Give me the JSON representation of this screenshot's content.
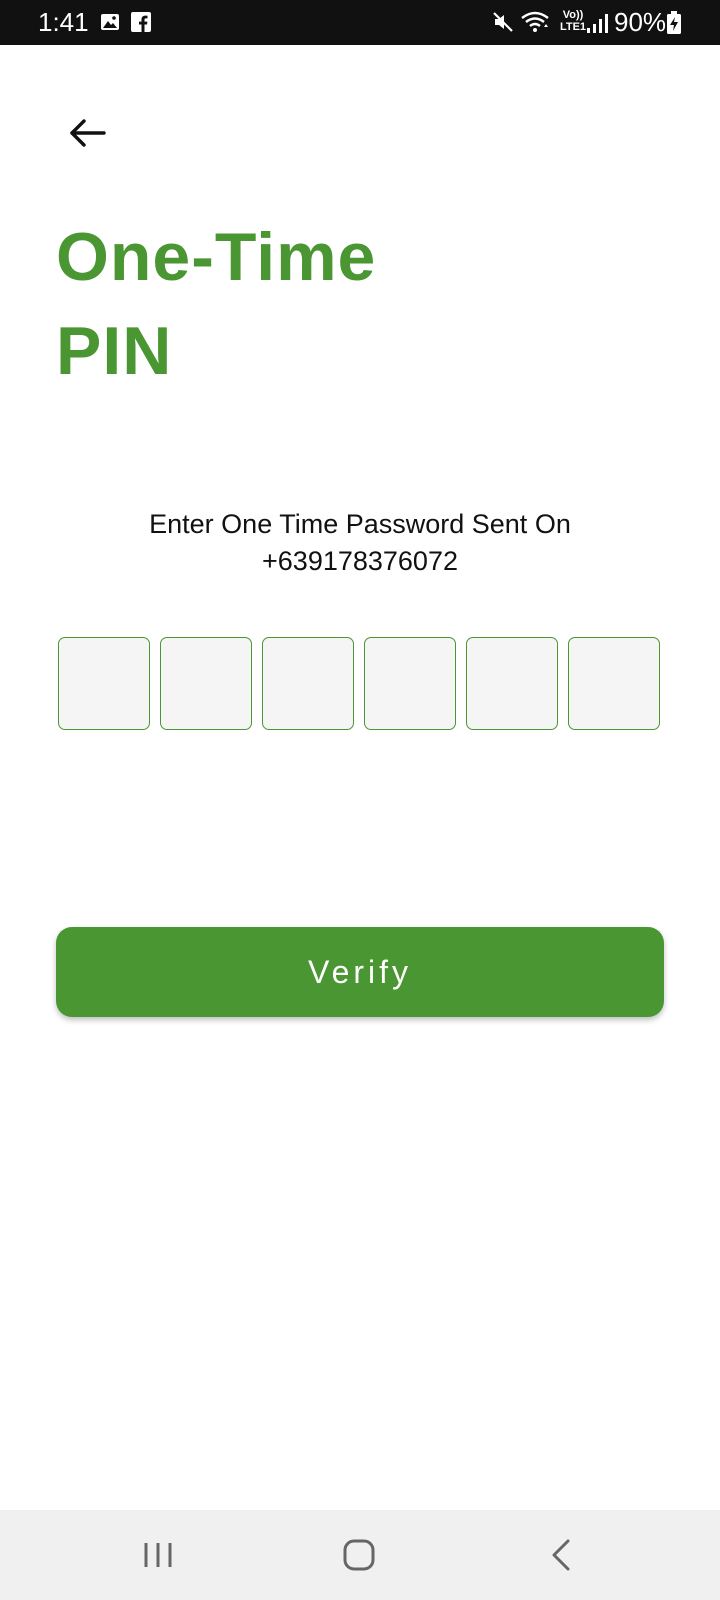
{
  "status_bar": {
    "time": "1:41",
    "battery": "90%",
    "lte": "Vo))\nLTE1",
    "icons": [
      "gallery-icon",
      "facebook-icon",
      "mute-icon",
      "wifi-icon",
      "lte-icon",
      "signal-icon",
      "battery-charging-icon"
    ]
  },
  "header": {
    "back_icon": "arrow-left-icon"
  },
  "title": {
    "line1": "One-Time",
    "line2": "PIN"
  },
  "instruction": {
    "line1": "Enter One Time Password Sent On",
    "phone": "+639178376072"
  },
  "otp": {
    "digits": [
      "",
      "",
      "",
      "",
      "",
      ""
    ]
  },
  "actions": {
    "verify_label": "Verify"
  },
  "nav_bar": {
    "icons": [
      "recent-apps-icon",
      "home-icon",
      "back-icon"
    ]
  },
  "colors": {
    "accent": "#4a9632",
    "status_bar": "#111111",
    "otp_fill": "#f5f5f5",
    "nav_bar": "#f0f0f0"
  }
}
